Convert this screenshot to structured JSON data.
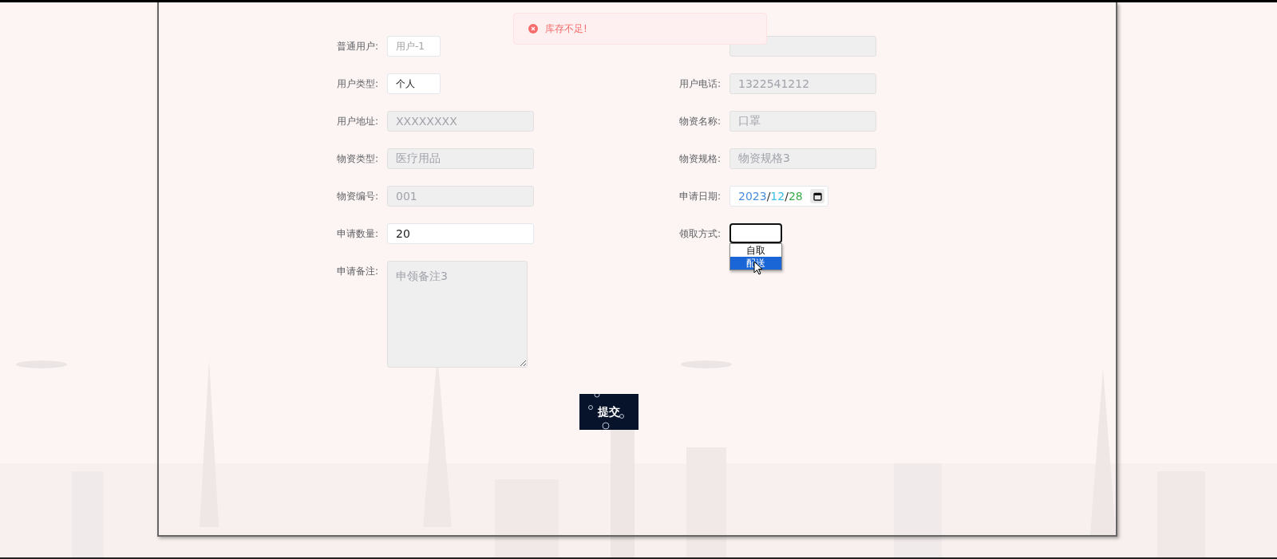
{
  "toast": {
    "kind": "error",
    "message": "库存不足!"
  },
  "fields": [
    {
      "label": "普通用户:",
      "kind": "short",
      "placeholder": "用户-1",
      "disabled": false
    },
    {
      "kind": "text",
      "disabled": true
    },
    {
      "label": "用户类型:",
      "kind": "short",
      "value": "个人",
      "disabled": false
    },
    {
      "label": "用户电话:",
      "kind": "text",
      "value": "1322541212",
      "disabled": true
    },
    {
      "label": "用户地址:",
      "kind": "text",
      "value": "XXXXXXXX",
      "disabled": true
    },
    {
      "label": "物资名称:",
      "kind": "text",
      "value": "口罩",
      "disabled": true
    },
    {
      "label": "物资类型:",
      "kind": "text",
      "value": "医疗用品",
      "disabled": true
    },
    {
      "label": "物资规格:",
      "kind": "text",
      "value": "物资规格3",
      "disabled": true
    },
    {
      "label": "物资编号:",
      "kind": "text",
      "value": "001",
      "disabled": true
    },
    {
      "label": "申请日期:",
      "kind": "date",
      "disabled": false,
      "parts": [
        {
          "text": "2023",
          "color": "#4a8ee0"
        },
        {
          "text": "/",
          "color": "#333333"
        },
        {
          "text": "12",
          "color": "#3cc0e6"
        },
        {
          "text": "/",
          "color": "#333333"
        },
        {
          "text": "28",
          "color": "#3aad4a"
        }
      ]
    },
    {
      "label": "申请数量:",
      "kind": "text",
      "value": "20",
      "disabled": false
    },
    {
      "label": "领取方式:",
      "kind": "select",
      "disabled": false,
      "options": [
        {
          "label": "自取",
          "selected": false
        },
        {
          "label": "配送",
          "selected": true
        }
      ]
    },
    {
      "label": "申请备注:",
      "kind": "textarea",
      "value": "申领备注3",
      "disabled": true
    }
  ],
  "submit": {
    "label": "提交"
  }
}
